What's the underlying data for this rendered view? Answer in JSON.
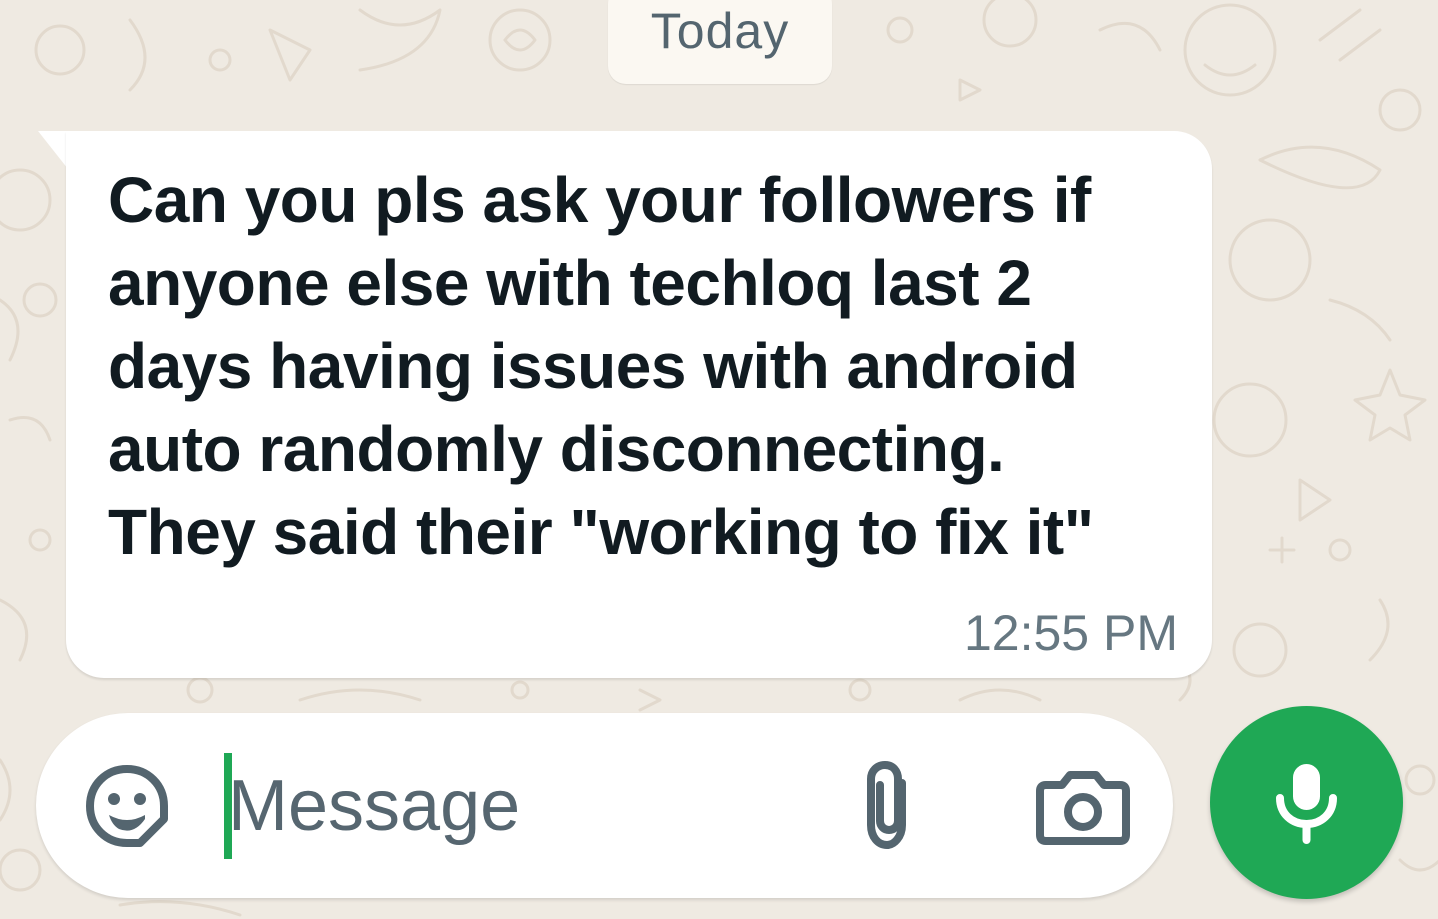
{
  "chat": {
    "date_divider": "Today",
    "message": {
      "text": "Can you pls ask your followers if\nanyone else with techloq last 2\ndays having issues with android\nauto randomly disconnecting.\nThey said their \"working to fix it\"",
      "time": "12:55 PM",
      "direction": "incoming"
    }
  },
  "composer": {
    "placeholder": "Message",
    "value": "",
    "icons": {
      "sticker": "sticker-icon",
      "attach": "paperclip-icon",
      "camera": "camera-icon",
      "send": "mic-icon"
    }
  },
  "colors": {
    "wallpaper": "#efeae2",
    "bubble_incoming": "#ffffff",
    "accent_green": "#1fa855",
    "text_primary": "#111b21",
    "text_secondary": "#667781",
    "icon_gray": "#54656f"
  }
}
